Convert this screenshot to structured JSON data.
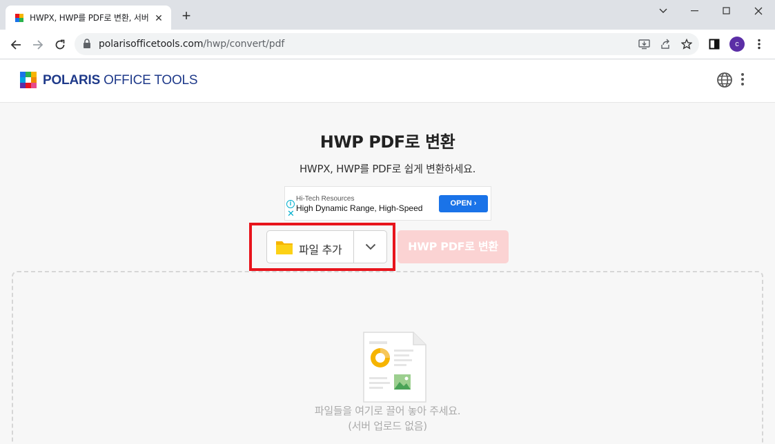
{
  "browser": {
    "tab_title": "HWPX, HWP를 PDF로 변환, 서버",
    "url_host": "polarisofficetools.com",
    "url_path": "/hwp/convert/pdf",
    "profile_initial": "c"
  },
  "header": {
    "logo_bold": "POLARIS",
    "logo_light": " OFFICE TOOLS"
  },
  "main": {
    "title": "HWP PDF로 변환",
    "subtitle": "HWPX, HWP를 PDF로 쉽게 변환하세요."
  },
  "ad": {
    "brand": "Hi-Tech Resources",
    "headline": "High Dynamic Range, High-Speed",
    "cta": "OPEN ›"
  },
  "actions": {
    "add_file_label": "파일 추가",
    "convert_label": "HWP PDF로 변환"
  },
  "dropzone": {
    "hint": "파일들을 여기로 끌어 놓아 주세요.",
    "note": "(서버 업로드 없음)"
  },
  "colors": {
    "accent_red": "#e8141c",
    "convert_disabled": "#fbd3d3",
    "brand_blue": "#1f3a8a"
  }
}
